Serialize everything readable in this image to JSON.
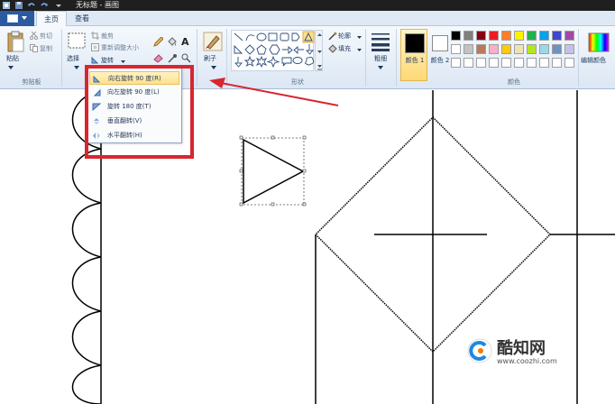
{
  "window": {
    "title": "无标题 - 画图"
  },
  "tabs": {
    "home": "主页",
    "view": "查看"
  },
  "clipboard": {
    "paste": "粘贴",
    "cut": "剪切",
    "copy": "复制",
    "group": "剪贴板"
  },
  "image": {
    "select": "选择",
    "crop": "裁剪",
    "resize": "重新调整大小",
    "rotate": "旋转"
  },
  "tools": {
    "text_icon": "A"
  },
  "brushes": {
    "label": "刷子"
  },
  "shapes": {
    "outline": "轮廓",
    "fill": "填充",
    "group": "形状"
  },
  "size": {
    "label": "粗细"
  },
  "colors": {
    "color1": "颜色 1",
    "color2": "颜色 2",
    "edit": "编辑颜色",
    "group": "颜色",
    "color1_value": "#000000",
    "color2_value": "#ffffff",
    "row1": [
      "#000000",
      "#7f7f7f",
      "#880015",
      "#ed1c24",
      "#ff7f27",
      "#fff200",
      "#22b14c",
      "#00a2e8",
      "#3f48cc",
      "#a349a4"
    ],
    "row2": [
      "#ffffff",
      "#c3c3c3",
      "#b97a57",
      "#ffaec9",
      "#ffc90e",
      "#efe4b0",
      "#b5e61d",
      "#99d9ea",
      "#7092be",
      "#c8bfe7"
    ],
    "row3": [
      "#ffffff",
      "#ffffff",
      "#ffffff",
      "#ffffff",
      "#ffffff",
      "#ffffff",
      "#ffffff",
      "#ffffff",
      "#ffffff",
      "#ffffff"
    ]
  },
  "rotate_menu": {
    "items": [
      {
        "label": "向右旋转 90 度(R)",
        "icon": "rotate-right-icon"
      },
      {
        "label": "向左旋转 90 度(L)",
        "icon": "rotate-left-icon"
      },
      {
        "label": "旋转 180 度(T)",
        "icon": "rotate-180-icon"
      },
      {
        "label": "垂直翻转(V)",
        "icon": "flip-vertical-icon"
      },
      {
        "label": "水平翻转(H)",
        "icon": "flip-horizontal-icon"
      }
    ]
  },
  "watermark": {
    "name": "酷知网",
    "url": "www.coozhi.com"
  },
  "accent": {
    "annotation": "#d8262f",
    "ribbon": "#dce7f4",
    "file_menu": "#2c5aa0"
  }
}
